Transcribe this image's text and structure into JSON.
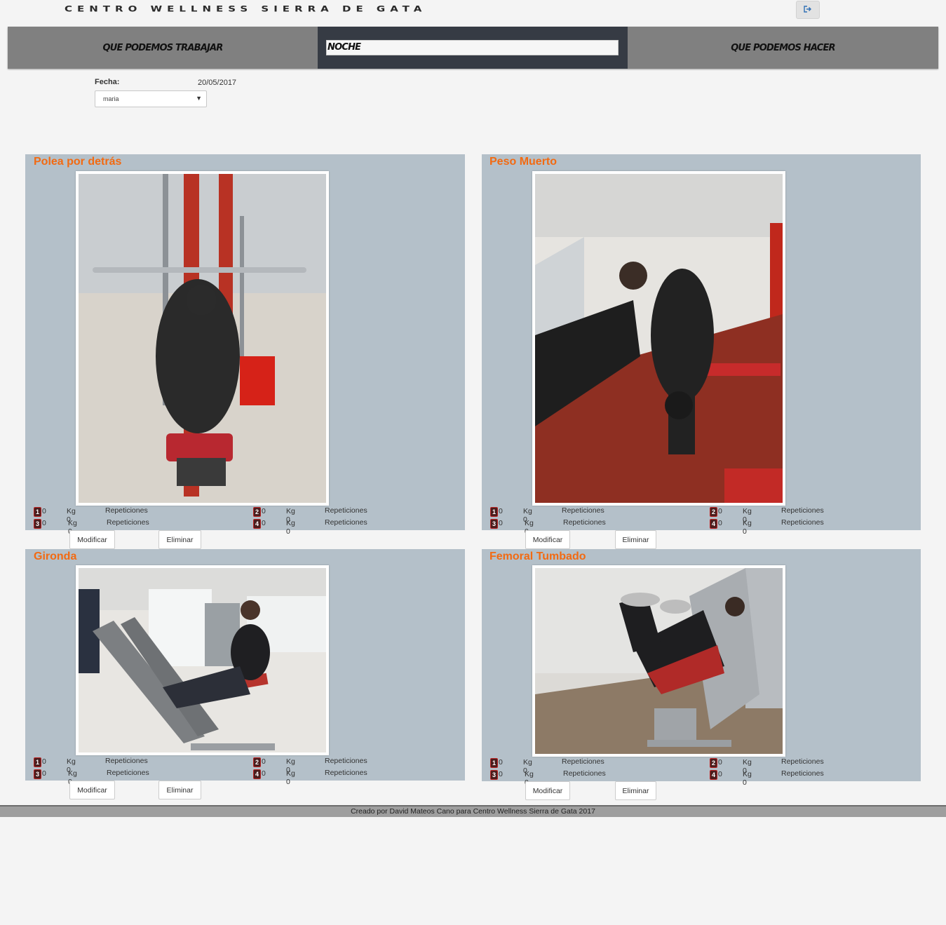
{
  "header": {
    "title": "CENTRO WELLNESS SIERRA DE GATA",
    "logout_icon": "sign-out-icon"
  },
  "nav": {
    "left_label": "QUE PODEMOS TRABAJAR",
    "middle_selected": "NOCHE",
    "right_label": "QUE PODEMOS HACER"
  },
  "form": {
    "fecha_label": "Fecha:",
    "fecha_value": "20/05/2017",
    "user_selected": "maria"
  },
  "exercises": [
    {
      "title": "Polea por detrás",
      "sets": [
        {
          "num": "1",
          "value": "0",
          "kg": "Kg 0",
          "reps": "Repeticiones"
        },
        {
          "num": "2",
          "value": "0",
          "kg": "Kg 0",
          "reps": "Repeticiones"
        },
        {
          "num": "3",
          "value": "0",
          "kg": "Kg 0",
          "reps": "Repeticiones"
        },
        {
          "num": "4",
          "value": "0",
          "kg": "Kg 0",
          "reps": "Repeticiones"
        }
      ],
      "modify_label": "Modificar",
      "delete_label": "Eliminar"
    },
    {
      "title": "Peso Muerto",
      "sets": [
        {
          "num": "1",
          "value": "0",
          "kg": "Kg 0",
          "reps": "Repeticiones"
        },
        {
          "num": "2",
          "value": "0",
          "kg": "Kg 0",
          "reps": "Repeticiones"
        },
        {
          "num": "3",
          "value": "0",
          "kg": "Kg 0",
          "reps": "Repeticiones"
        },
        {
          "num": "4",
          "value": "0",
          "kg": "Kg 0",
          "reps": "Repeticiones"
        }
      ],
      "modify_label": "Modificar",
      "delete_label": "Eliminar"
    },
    {
      "title": "Gironda",
      "sets": [
        {
          "num": "1",
          "value": "0",
          "kg": "Kg 0",
          "reps": "Repeticiones"
        },
        {
          "num": "2",
          "value": "0",
          "kg": "Kg 0",
          "reps": "Repeticiones"
        },
        {
          "num": "3",
          "value": "0",
          "kg": "Kg 0",
          "reps": "Repeticiones"
        },
        {
          "num": "4",
          "value": "0",
          "kg": "Kg 0",
          "reps": "Repeticiones"
        }
      ],
      "modify_label": "Modificar",
      "delete_label": "Eliminar"
    },
    {
      "title": "Femoral Tumbado",
      "sets": [
        {
          "num": "1",
          "value": "0",
          "kg": "Kg 0",
          "reps": "Repeticiones"
        },
        {
          "num": "2",
          "value": "0",
          "kg": "Kg 0",
          "reps": "Repeticiones"
        },
        {
          "num": "3",
          "value": "0",
          "kg": "Kg 0",
          "reps": "Repeticiones"
        },
        {
          "num": "4",
          "value": "0",
          "kg": "Kg 0",
          "reps": "Repeticiones"
        }
      ],
      "modify_label": "Modificar",
      "delete_label": "Eliminar"
    }
  ],
  "footer": {
    "text": "Creado por David Mateos Cano para Centro Wellness Sierra de Gata 2017"
  },
  "colors": {
    "accent": "#f26a12",
    "panel": "#b4c0c9",
    "nav": "#808080",
    "nav_active": "#363b44"
  }
}
